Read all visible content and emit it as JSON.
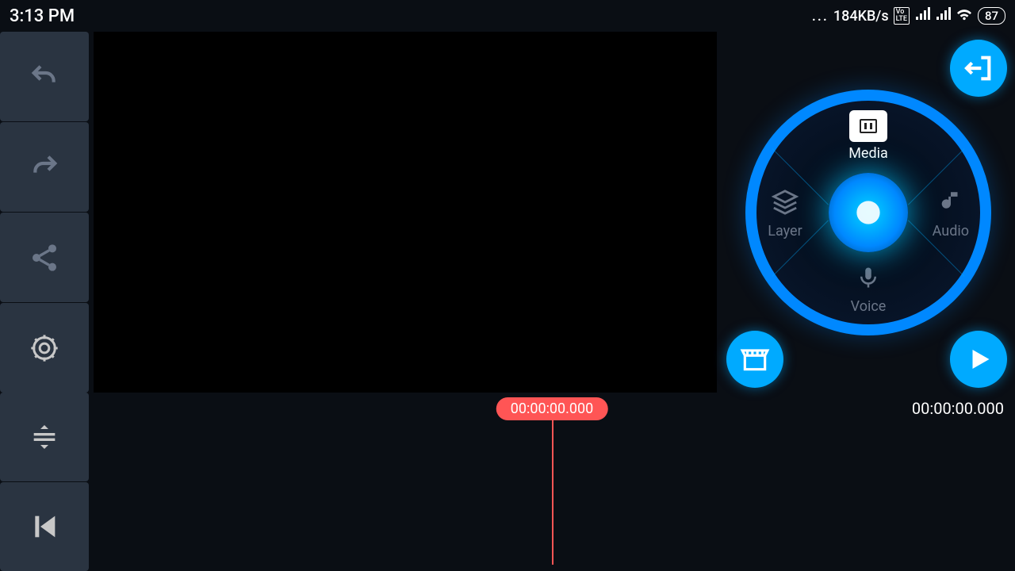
{
  "status": {
    "time": "3:13 PM",
    "speed": "184KB/s",
    "battery": "87"
  },
  "wheel": {
    "media": "Media",
    "layer": "Layer",
    "audio": "Audio",
    "voice": "Voice"
  },
  "timeline": {
    "playhead": "00:00:00.000",
    "total": "00:00:00.000"
  }
}
